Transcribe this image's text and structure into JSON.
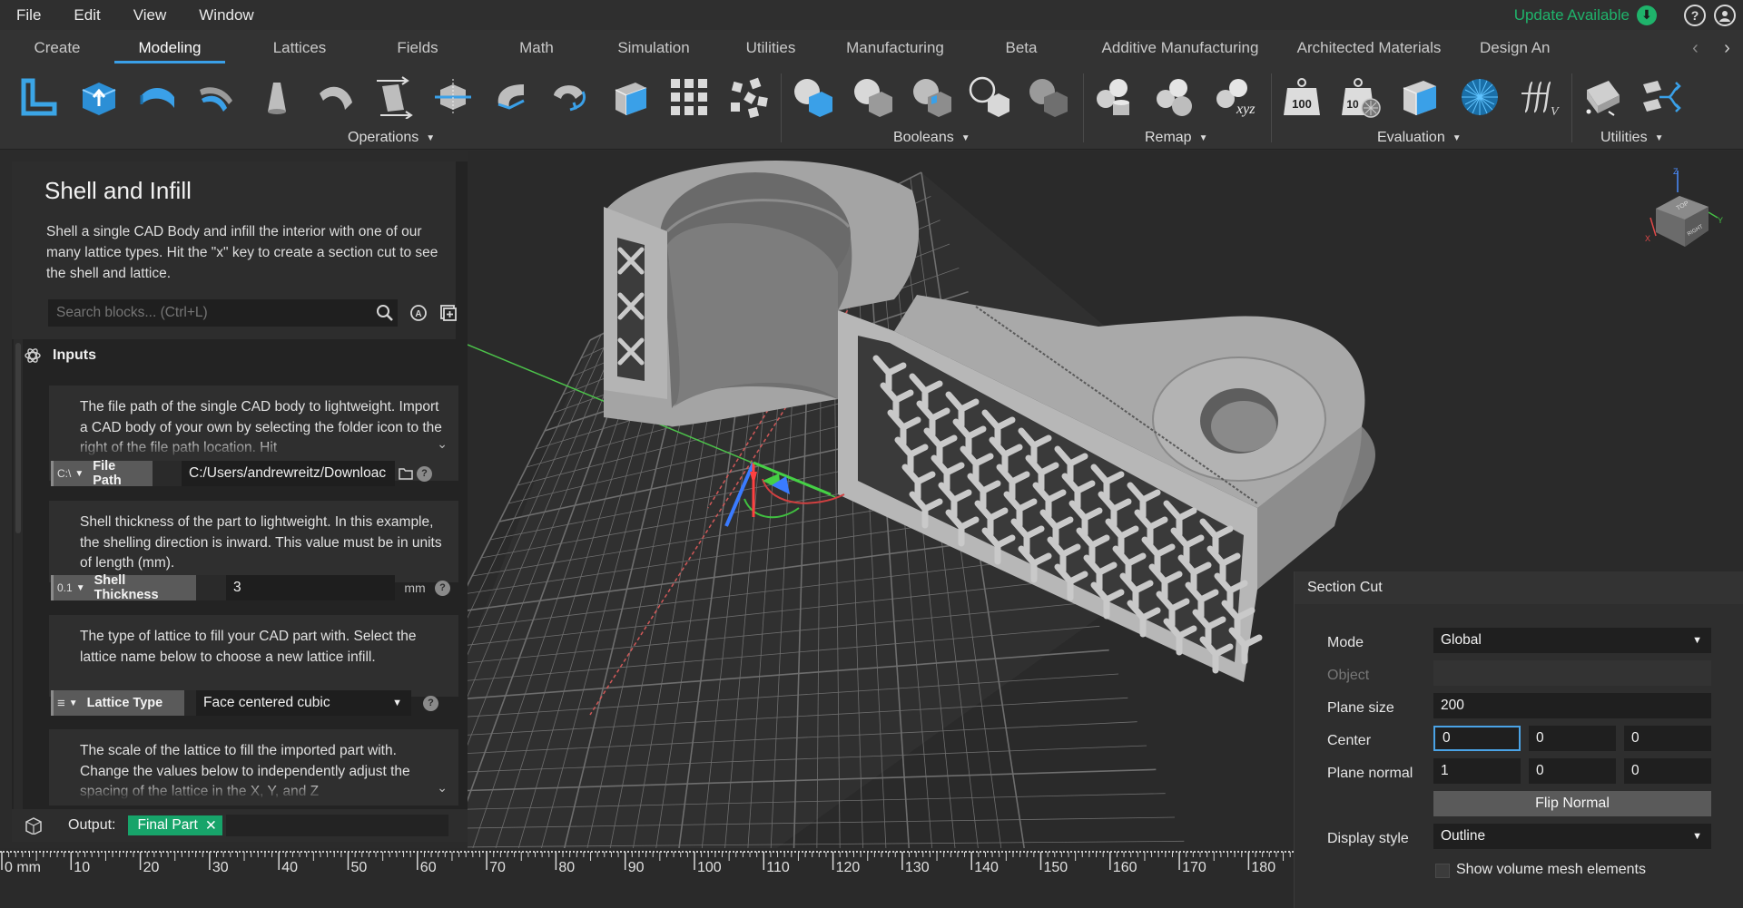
{
  "menu": [
    "File",
    "Edit",
    "View",
    "Window"
  ],
  "update": {
    "label": "Update Available"
  },
  "tabs": [
    "Create",
    "Modeling",
    "Lattices",
    "Fields",
    "Math",
    "Simulation",
    "Utilities",
    "Manufacturing",
    "Beta",
    "Additive Manufacturing",
    "Architected Materials",
    "Design An"
  ],
  "active_tab": "Modeling",
  "toolbar_groups": {
    "operations": "Operations",
    "booleans": "Booleans",
    "remap": "Remap",
    "evaluation": "Evaluation",
    "utilities": "Utilities"
  },
  "tool_icon_text": {
    "weight_100": "100",
    "weight_10": "10",
    "xyz": "xyz"
  },
  "panel": {
    "title": "Shell and Infill",
    "description": "Shell a single CAD Body and infill the interior with one of our many lattice types. Hit the \"x\" key to create a section cut to see the shell and lattice.",
    "search_placeholder": "Search blocks... (Ctrl+L)",
    "inputs_label": "Inputs",
    "cards": [
      {
        "description": "The file path of the single CAD body to lightweight. Import a CAD body of your own by selecting the folder icon to the right of the file path location. Hit",
        "type_tag": "C:\\",
        "label": "File Path",
        "value": "C:/Users/andrewreitz/Downloac"
      },
      {
        "description": "Shell thickness of the part to lightweight. In this example, the shelling direction is inward. This value must be in units of length (mm).",
        "type_tag": "0.1",
        "label": "Shell Thickness",
        "value": "3",
        "unit": "mm"
      },
      {
        "description": "The type of lattice to fill your CAD part with. Select the lattice name below to choose a new lattice infill.",
        "type_tag": "≡",
        "label": "Lattice Type",
        "value": "Face centered cubic"
      },
      {
        "description": "The scale of the lattice to fill the imported part with. Change the values below to independently adjust the spacing of the lattice in the X, Y, and Z"
      }
    ],
    "output_label": "Output:",
    "output_value": "Final Part"
  },
  "ruler": {
    "unit": "mm",
    "labels": [
      "0 mm",
      "10",
      "20",
      "30",
      "40",
      "50",
      "60",
      "70",
      "80",
      "90",
      "100",
      "110",
      "120",
      "130",
      "140",
      "150",
      "160",
      "170",
      "180"
    ]
  },
  "viewcube": {
    "top": "TOP",
    "right": "RIGHT",
    "axis_x": "X",
    "axis_y": "Y",
    "axis_z": "Z"
  },
  "section_cut": {
    "title": "Section Cut",
    "mode_label": "Mode",
    "mode_value": "Global",
    "object_label": "Object",
    "plane_size_label": "Plane size",
    "plane_size_value": "200",
    "center_label": "Center",
    "center": [
      "0",
      "0",
      "0"
    ],
    "plane_normal_label": "Plane normal",
    "plane_normal": [
      "1",
      "0",
      "0"
    ],
    "flip_label": "Flip Normal",
    "display_style_label": "Display style",
    "display_style_value": "Outline",
    "show_mesh_label": "Show volume mesh elements",
    "show_mesh_checked": false
  },
  "colors": {
    "accent": "#3aa0e8",
    "update_green": "#1fb36b",
    "output_chip": "#17a46a",
    "model_gray": "#a9a9a9"
  }
}
